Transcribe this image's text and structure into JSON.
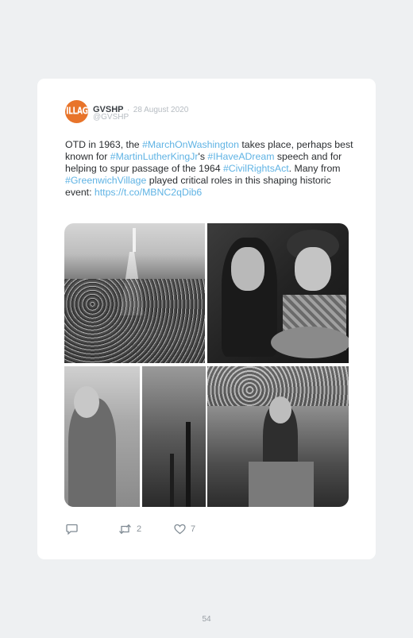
{
  "tweet": {
    "avatar_text": "VILLAGE",
    "name": "GVSHP",
    "separator": "·",
    "date": "28 August 2020",
    "handle": "@GVSHP",
    "text": {
      "s1": "OTD in 1963, the ",
      "tag1": "#MarchOnWashington",
      "s2": " takes place, perhaps best known for ",
      "tag2": "#MartinLutherKingJr",
      "s3": "'s ",
      "tag3": "#IHaveADream",
      "s4": " speech and for helping to spur passage of the 1964 ",
      "tag4": "#CivilRightsAct",
      "s5": ". Many from ",
      "tag5": "#GreenwichVillage",
      "s6": " played critical roles in this shaping historic event: ",
      "link": "https://t.co/MBNC2qDib6"
    },
    "actions": {
      "reply_icon": "reply-icon",
      "retweet_icon": "retweet-icon",
      "retweet_count": "2",
      "like_icon": "heart-icon",
      "like_count": "7"
    }
  },
  "page_number": "54",
  "colors": {
    "background": "#eef0f2",
    "card": "#ffffff",
    "hashtag": "#5fb3e4",
    "avatar": "#e8742a",
    "muted": "#b6bcc2"
  }
}
